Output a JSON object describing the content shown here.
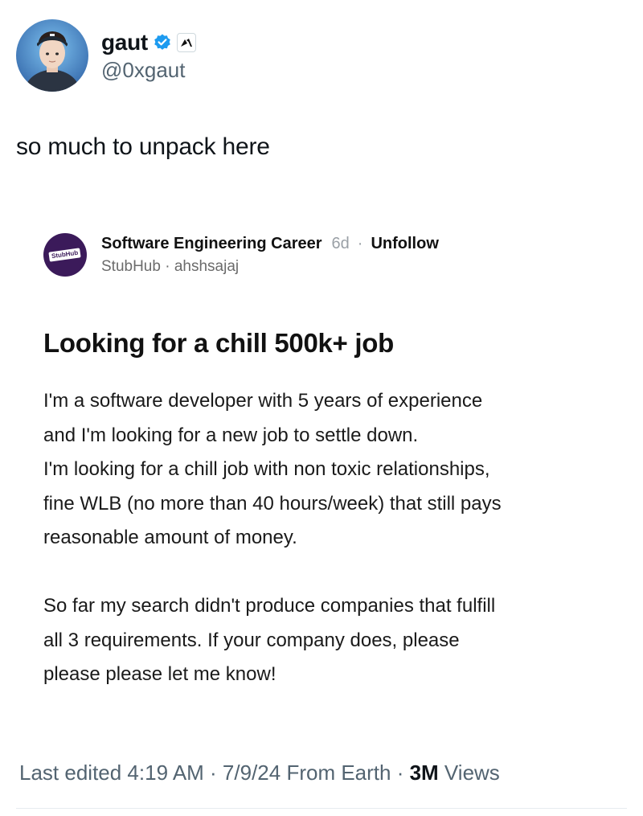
{
  "author": {
    "display_name": "gaut",
    "handle": "@0xgaut",
    "verified_icon": "verified-badge-icon",
    "affiliation_icon": "affiliation-badge-icon",
    "verified_color": "#1d9bf0"
  },
  "tweet": {
    "text": "so much to unpack here"
  },
  "embedded_post": {
    "logo_text": "StubHub",
    "logo_color": "#3b1a5a",
    "community": "Software Engineering Career",
    "age": "6d",
    "separator": "·",
    "unfollow_label": "Unfollow",
    "subline": "StubHub · ahshsajaj",
    "title": "Looking for a chill 500k+ job",
    "paragraph1": [
      "I'm a software developer with 5 years of experience",
      "and I'm looking for a new job to settle down.",
      "I'm looking for a chill job with non toxic relationships,",
      "fine WLB (no more than 40 hours/week) that still pays",
      "reasonable amount of money."
    ],
    "paragraph2": [
      "So far my search didn't produce companies that fulfill",
      "all 3 requirements. If your company does, please",
      "please please let me know!"
    ]
  },
  "footer": {
    "meta": "Last edited 4:19 AM · 7/9/24  From Earth · ",
    "views_count": "3M",
    "views_label": " Views"
  }
}
